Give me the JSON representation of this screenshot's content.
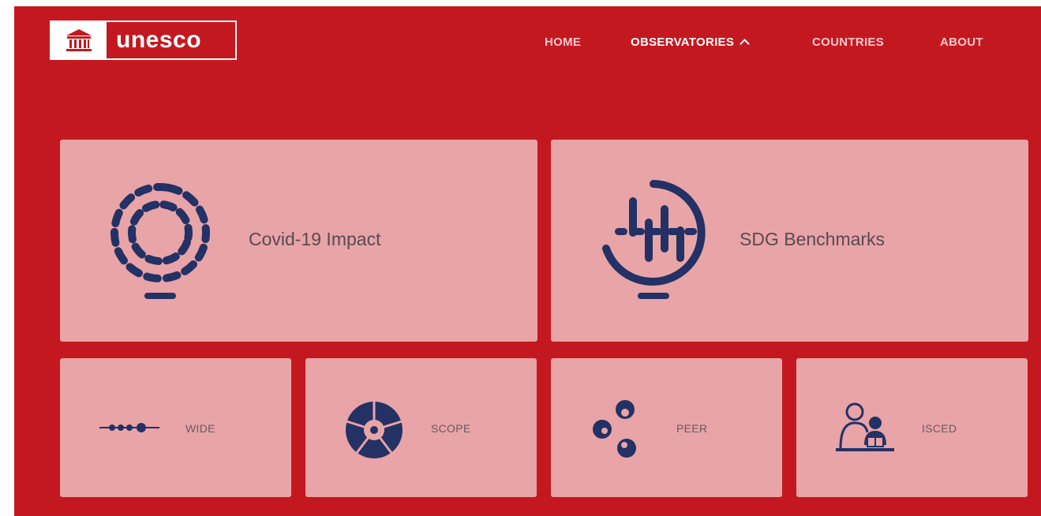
{
  "header": {
    "logo_text": "unesco",
    "nav": [
      {
        "label": "HOME"
      },
      {
        "label": "OBSERVATORIES"
      },
      {
        "label": "COUNTRIES"
      },
      {
        "label": "ABOUT"
      }
    ]
  },
  "cards": {
    "featured": [
      {
        "label": "Covid-19 Impact",
        "icon": "dotted-rings-icon"
      },
      {
        "label": "SDG Benchmarks",
        "icon": "globe-bars-icon"
      }
    ],
    "secondary": [
      {
        "label": "WIDE",
        "icon": "dotted-line-icon"
      },
      {
        "label": "SCOPE",
        "icon": "aperture-icon"
      },
      {
        "label": "PEER",
        "icon": "circles-icon"
      },
      {
        "label": "ISCED",
        "icon": "teacher-student-icon"
      }
    ]
  },
  "colors": {
    "background": "#c41820",
    "card": "#e8a4a7",
    "icon": "#233165",
    "nav_active": "#ffffff",
    "nav_inactive": "#f6c9cc"
  }
}
